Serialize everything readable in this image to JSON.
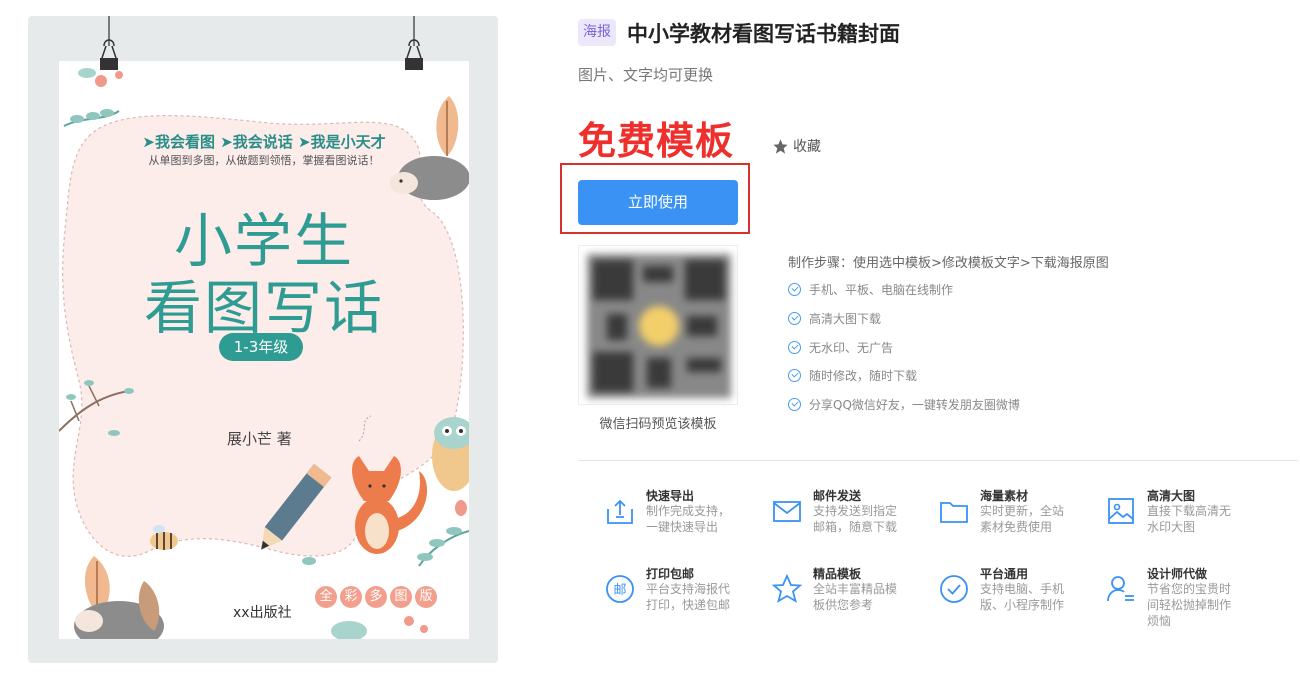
{
  "poster": {
    "tagline": "➤我会看图 ➤我会说话 ➤我是小天才",
    "sub_tagline": "从单图到多图，从做题到领悟，掌握看图说话！",
    "title_line1": "小学生",
    "title_line2": "看图写话",
    "grade": "1-3年级",
    "author": "展小芒  著",
    "publisher": "xx出版社",
    "colorful_chars": [
      "全",
      "彩",
      "多",
      "图",
      "版"
    ]
  },
  "header": {
    "type_badge": "海报",
    "title": "中小学教材看图写话书籍封面",
    "subtitle": "图片、文字均可更换"
  },
  "pricing": {
    "price_label": "免费模板",
    "favorite_label": "收藏",
    "use_button_label": "立即使用"
  },
  "qr": {
    "caption": "微信扫码预览该模板"
  },
  "steps": {
    "title": "制作步骤：使用选中模板>修改模板文字>下载海报原图",
    "features": [
      "手机、平板、电脑在线制作",
      "高清大图下载",
      "无水印、无广告",
      "随时修改，随时下载",
      "分享QQ微信好友，一键转发朋友圈微博"
    ]
  },
  "benefits": [
    {
      "title": "快速导出",
      "desc": "制作完成支持，一键快速导出",
      "icon": "export-icon"
    },
    {
      "title": "邮件发送",
      "desc": "支持发送到指定邮箱，随意下载",
      "icon": "mail-icon"
    },
    {
      "title": "海量素材",
      "desc": "实时更新，全站素材免费使用",
      "icon": "folder-icon"
    },
    {
      "title": "高清大图",
      "desc": "直接下载高清无水印大图",
      "icon": "image-icon"
    },
    {
      "title": "打印包邮",
      "desc": "平台支持海报代打印，快递包邮",
      "icon": "post-icon"
    },
    {
      "title": "精品模板",
      "desc": "全站丰富精品模板供您参考",
      "icon": "star-icon"
    },
    {
      "title": "平台通用",
      "desc": "支持电脑、手机版、小程序制作",
      "icon": "check-icon"
    },
    {
      "title": "设计师代做",
      "desc": "节省您的宝贵时间轻松抛掉制作烦恼",
      "icon": "designer-icon"
    }
  ],
  "colors": {
    "accent_blue": "#3a92f4",
    "price_red": "#ee2f2c",
    "highlight_red": "#d8302c",
    "poster_teal": "#2f9c94",
    "badge_purple": "#7b63d8"
  }
}
